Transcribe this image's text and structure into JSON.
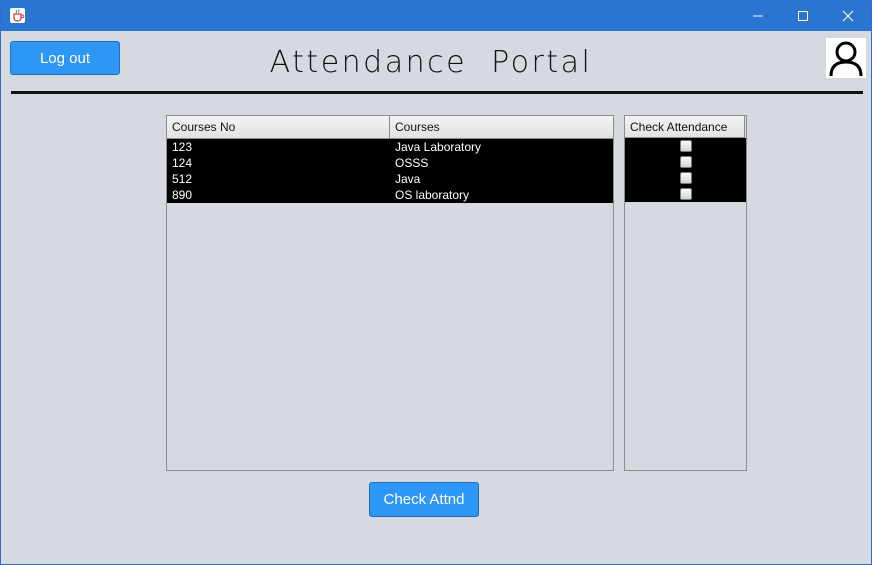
{
  "window": {
    "icon": "java-cup-icon",
    "controls": {
      "minimize": "minimize-icon",
      "maximize": "maximize-icon",
      "close": "close-icon"
    }
  },
  "header": {
    "logout_label": "Log out",
    "title": "Attendance  Portal",
    "avatar_icon": "user-icon"
  },
  "courses_table": {
    "columns": [
      "Courses No",
      "Courses"
    ],
    "rows": [
      {
        "no": "123",
        "course": "Java Laboratory"
      },
      {
        "no": "124",
        "course": "OSSS"
      },
      {
        "no": "512",
        "course": "Java"
      },
      {
        "no": "890",
        "course": "OS laboratory"
      }
    ]
  },
  "attendance_table": {
    "header": "Check Attendance",
    "checked": [
      false,
      false,
      false,
      false
    ]
  },
  "actions": {
    "check_label": "Check Attnd"
  },
  "colors": {
    "titlebar": "#2a75d0",
    "button": "#2e97f5",
    "background": "#d6d9e0",
    "selected_row": "#000000"
  }
}
